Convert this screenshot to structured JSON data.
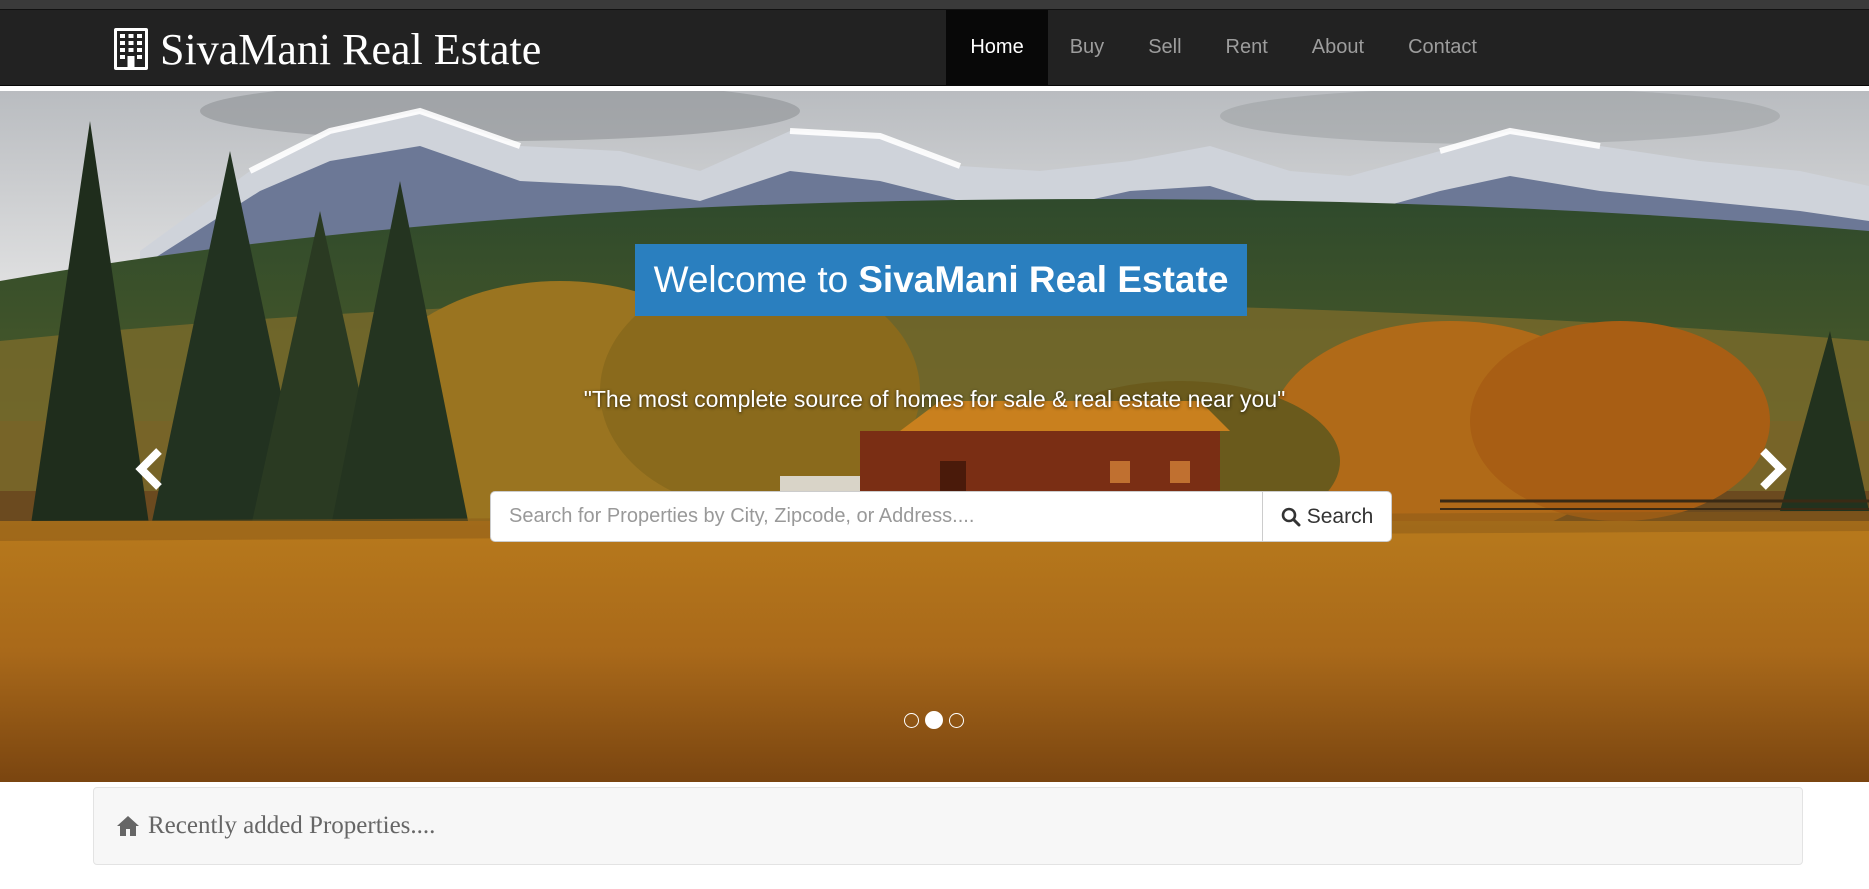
{
  "brand": {
    "name": "SivaMani Real Estate",
    "icon": "building-icon"
  },
  "nav": {
    "items": [
      {
        "label": "Home",
        "active": true
      },
      {
        "label": "Buy",
        "active": false
      },
      {
        "label": "Sell",
        "active": false
      },
      {
        "label": "Rent",
        "active": false
      },
      {
        "label": "About",
        "active": false
      },
      {
        "label": "Contact",
        "active": false
      }
    ]
  },
  "hero": {
    "welcome_prefix": "Welcome to",
    "welcome_bold": "SivaMani Real Estate",
    "tagline": "\"The most complete source of homes for sale & real estate near you\"",
    "search_placeholder": "Search for Properties by City, Zipcode, or Address....",
    "search_button": "Search",
    "slides_total": 3,
    "active_slide": 2,
    "colors": {
      "welcome_bg": "#2a7fbf"
    }
  },
  "recent": {
    "label": "Recently added Properties....",
    "icon": "home-icon"
  },
  "colors": {
    "navbar_bg": "#222222",
    "nav_active_bg": "#080808",
    "nav_text": "#9d9d9d"
  }
}
